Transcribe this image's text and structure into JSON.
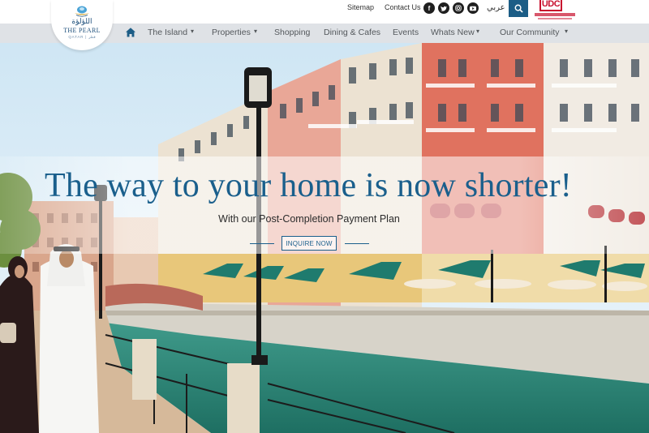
{
  "header": {
    "links": {
      "sitemap": "Sitemap",
      "contact": "Contact Us",
      "arabic": "عربي"
    },
    "social_icons": [
      "facebook-icon",
      "twitter-icon",
      "instagram-icon",
      "youtube-icon"
    ],
    "brand": {
      "logo_arabic": "اللؤلؤة",
      "logo_name": "THE PEARL",
      "logo_sub": "QATAR | قطر",
      "partner_logo_text": "UDC"
    }
  },
  "nav": {
    "items": [
      {
        "label": "The Island",
        "dropdown": true
      },
      {
        "label": "Properties",
        "dropdown": true
      },
      {
        "label": "Shopping",
        "dropdown": false
      },
      {
        "label": "Dining & Cafes",
        "dropdown": false
      },
      {
        "label": "Events",
        "dropdown": false
      },
      {
        "label": "Whats New",
        "dropdown": true
      },
      {
        "label": "Our Community",
        "dropdown": true
      }
    ]
  },
  "hero": {
    "title": "The way to your home is now shorter!",
    "subtitle": "With our Post-Completion Payment Plan",
    "cta": "INQUIRE NOW"
  },
  "colors": {
    "brand_blue": "#1a5f8c",
    "nav_bg": "#dfe2e6",
    "search_bg": "#1c5d86",
    "udc_red": "#c8102e",
    "canal": "#2e8a7c"
  }
}
